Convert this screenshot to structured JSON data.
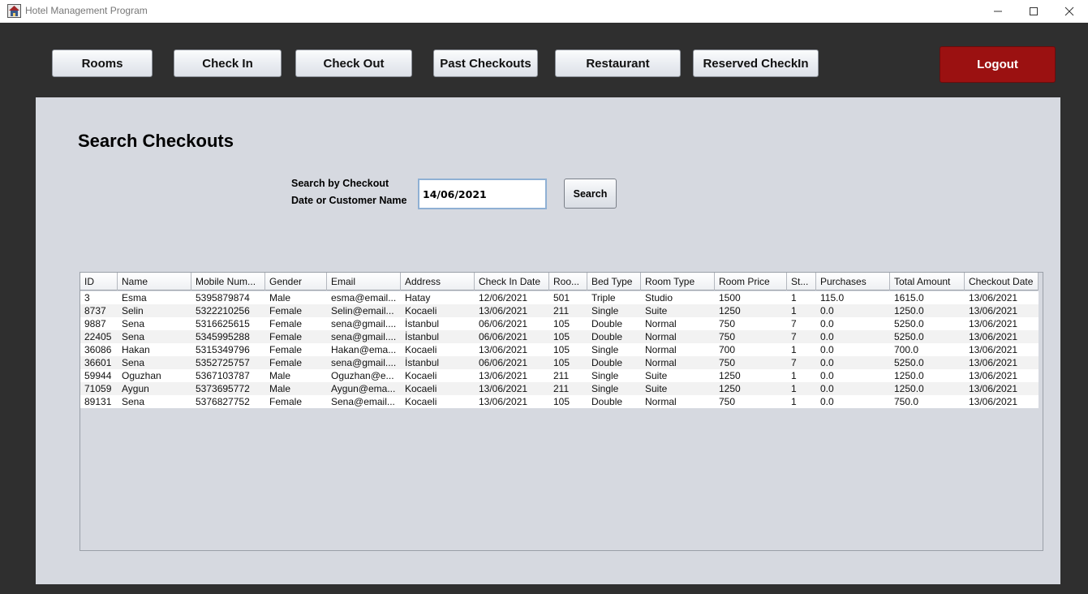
{
  "window": {
    "title": "Hotel Management Program"
  },
  "nav": {
    "rooms": "Rooms",
    "check_in": "Check In",
    "check_out": "Check Out",
    "past_checkouts": "Past Checkouts",
    "restaurant": "Restaurant",
    "reserved_checkin": "Reserved CheckIn",
    "logout": "Logout"
  },
  "colors": {
    "logout": "#9b1111",
    "panel": "#d6d9e0",
    "frame": "#2f2f2f"
  },
  "page": {
    "title": "Search Checkouts",
    "search_label_line1": "Search by Checkout",
    "search_label_line2": "Date or Customer Name",
    "search_value": "14/06/2021",
    "search_button": "Search"
  },
  "table": {
    "columns": [
      "ID",
      "Name",
      "Mobile Num...",
      "Gender",
      "Email",
      "Address",
      "Check In Date",
      "Roo...",
      "Bed Type",
      "Room Type",
      "Room Price",
      "St...",
      "Purchases",
      "Total Amount",
      "Checkout Date"
    ],
    "rows": [
      [
        "3",
        "Esma",
        "5395879874",
        "Male",
        "esma@email...",
        "Hatay",
        "12/06/2021",
        "501",
        "Triple",
        "Studio",
        "1500",
        "1",
        "115.0",
        "1615.0",
        "13/06/2021"
      ],
      [
        "8737",
        "Selin",
        "5322210256",
        "Female",
        "Selin@email...",
        "Kocaeli",
        "13/06/2021",
        "211",
        "Single",
        "Suite",
        "1250",
        "1",
        "0.0",
        "1250.0",
        "13/06/2021"
      ],
      [
        "9887",
        "Sena",
        "5316625615",
        "Female",
        "sena@gmail....",
        "İstanbul",
        "06/06/2021",
        "105",
        "Double",
        "Normal",
        "750",
        "7",
        "0.0",
        "5250.0",
        "13/06/2021"
      ],
      [
        "22405",
        "Sena",
        "5345995288",
        "Female",
        "sena@gmail....",
        "İstanbul",
        "06/06/2021",
        "105",
        "Double",
        "Normal",
        "750",
        "7",
        "0.0",
        "5250.0",
        "13/06/2021"
      ],
      [
        "36086",
        "Hakan",
        "5315349796",
        "Female",
        "Hakan@ema...",
        "Kocaeli",
        "13/06/2021",
        "105",
        "Single",
        "Normal",
        "700",
        "1",
        "0.0",
        "700.0",
        "13/06/2021"
      ],
      [
        "36601",
        "Sena",
        "5352725757",
        "Female",
        "sena@gmail....",
        "İstanbul",
        "06/06/2021",
        "105",
        "Double",
        "Normal",
        "750",
        "7",
        "0.0",
        "5250.0",
        "13/06/2021"
      ],
      [
        "59944",
        "Oguzhan",
        "5367103787",
        "Male",
        "Oguzhan@e...",
        "Kocaeli",
        "13/06/2021",
        "211",
        "Single",
        "Suite",
        "1250",
        "1",
        "0.0",
        "1250.0",
        "13/06/2021"
      ],
      [
        "71059",
        "Aygun",
        "5373695772",
        "Male",
        "Aygun@ema...",
        "Kocaeli",
        "13/06/2021",
        "211",
        "Single",
        "Suite",
        "1250",
        "1",
        "0.0",
        "1250.0",
        "13/06/2021"
      ],
      [
        "89131",
        "Sena",
        "5376827752",
        "Female",
        "Sena@email...",
        "Kocaeli",
        "13/06/2021",
        "105",
        "Double",
        "Normal",
        "750",
        "1",
        "0.0",
        "750.0",
        "13/06/2021"
      ]
    ]
  }
}
